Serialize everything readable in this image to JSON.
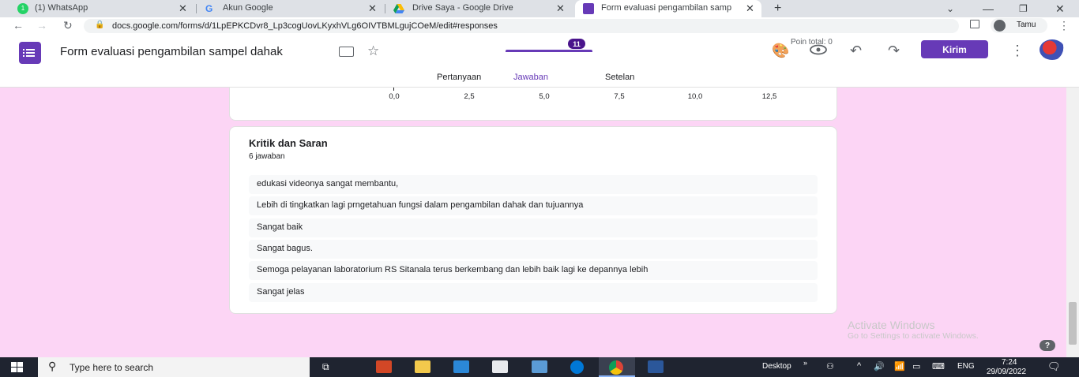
{
  "browser": {
    "tabs": [
      {
        "title": "(1) WhatsApp",
        "badge": "1"
      },
      {
        "title": "Akun Google"
      },
      {
        "title": "Drive Saya - Google Drive"
      },
      {
        "title": "Form evaluasi pengambilan samp"
      }
    ],
    "url": "docs.google.com/forms/d/1LpEPKCDvr8_Lp3cogUovLKyxhVLg6OIVTBMLgujCOeM/edit#responses",
    "profile_label": "Tamu"
  },
  "forms": {
    "title": "Form evaluasi pengambilan sampel dahak",
    "send_label": "Kirim",
    "tabs": [
      {
        "label": "Pertanyaan"
      },
      {
        "label": "Jawaban",
        "count": "11"
      },
      {
        "label": "Setelan"
      }
    ],
    "points_label": "Poin total: 0"
  },
  "chart_axis": {
    "ticks": [
      "0,0",
      "2,5",
      "5,0",
      "7,5",
      "10,0",
      "12,5"
    ]
  },
  "question": {
    "title": "Kritik dan Saran",
    "count_label": "6 jawaban",
    "answers": [
      "edukasi videonya sangat membantu,",
      "Lebih di tingkatkan lagi prngetahuan fungsi dalam pengambilan dahak dan tujuannya",
      "Sangat baik",
      "Sangat bagus.",
      "Semoga pelayanan laboratorium RS Sitanala terus berkembang dan lebih baik lagi ke depannya lebih",
      "Sangat jelas"
    ]
  },
  "watermark": {
    "title": "Activate Windows",
    "subtitle": "Go to Settings to activate Windows."
  },
  "help_label": "?",
  "taskbar": {
    "search_placeholder": "Type here to search",
    "desktop_label": "Desktop",
    "language": "ENG",
    "time": "7:24",
    "date": "29/09/2022"
  },
  "colors": {
    "accent": "#673ab7",
    "page_background": "#fcd5f5"
  }
}
